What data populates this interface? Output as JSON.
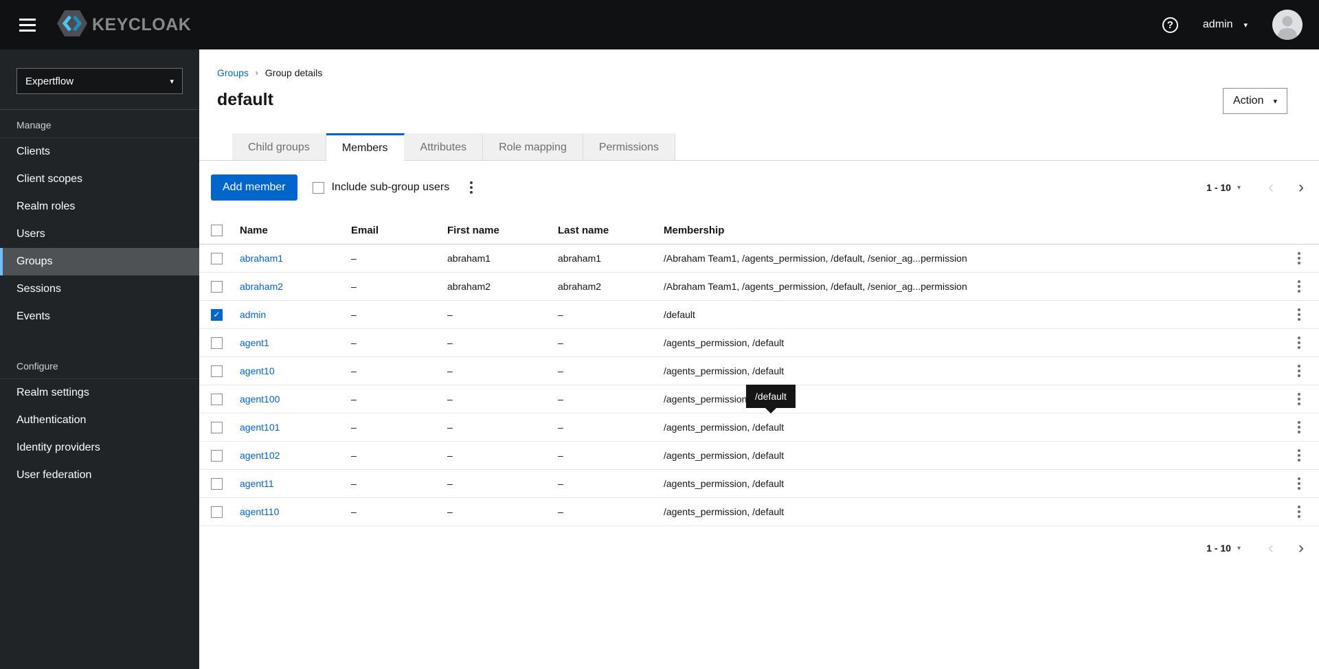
{
  "colors": {
    "accent": "#0066cc",
    "masthead_bg": "#0f1113",
    "sidebar_bg": "#212427",
    "nav_selected_bg": "#4f5255",
    "nav_selected_border": "#73bcf7",
    "tab_inactive_bg": "#f0f0f0",
    "link": "#0066cc",
    "tooltip_bg": "#151515",
    "brand_cyan": "#3fc0ee"
  },
  "icons": {
    "help": "?",
    "caret_down": "▾",
    "chevron_left": "‹",
    "chevron_right": "›",
    "breadcrumb_separator": "›",
    "check": "✓"
  },
  "masthead": {
    "brand": "KEYCLOAK",
    "username": "admin"
  },
  "sidebar": {
    "realm": "Expertflow",
    "selected": "Groups",
    "sections": [
      {
        "label": "Manage",
        "items": [
          "Clients",
          "Client scopes",
          "Realm roles",
          "Users",
          "Groups",
          "Sessions",
          "Events"
        ]
      },
      {
        "label": "Configure",
        "items": [
          "Realm settings",
          "Authentication",
          "Identity providers",
          "User federation"
        ]
      }
    ]
  },
  "breadcrumb": {
    "items": [
      "Groups",
      "Group details"
    ]
  },
  "header": {
    "title": "default",
    "action_label": "Action"
  },
  "tabs": {
    "active": "Members",
    "items": [
      "Child groups",
      "Members",
      "Attributes",
      "Role mapping",
      "Permissions"
    ]
  },
  "toolbar": {
    "add_member_label": "Add member",
    "include_subgroup_label": "Include sub-group users"
  },
  "pagination": {
    "range": "1 - 10"
  },
  "table": {
    "headers": [
      "Name",
      "Email",
      "First name",
      "Last name",
      "Membership"
    ],
    "rows": [
      {
        "name": "abraham1",
        "email": "–",
        "first_name": "abraham1",
        "last_name": "abraham1",
        "membership": "/Abraham Team1, /agents_permission, /default, /senior_ag...permission",
        "checked": false
      },
      {
        "name": "abraham2",
        "email": "–",
        "first_name": "abraham2",
        "last_name": "abraham2",
        "membership": "/Abraham Team1, /agents_permission, /default, /senior_ag...permission",
        "checked": false
      },
      {
        "name": "admin",
        "email": "–",
        "first_name": "–",
        "last_name": "–",
        "membership": "/default",
        "checked": true
      },
      {
        "name": "agent1",
        "email": "–",
        "first_name": "–",
        "last_name": "–",
        "membership": "/agents_permission, /default",
        "checked": false
      },
      {
        "name": "agent10",
        "email": "–",
        "first_name": "–",
        "last_name": "–",
        "membership": "/agents_permission, /default",
        "checked": false
      },
      {
        "name": "agent100",
        "email": "–",
        "first_name": "–",
        "last_name": "–",
        "membership": "/agents_permission, /default",
        "checked": false
      },
      {
        "name": "agent101",
        "email": "–",
        "first_name": "–",
        "last_name": "–",
        "membership": "/agents_permission, /default",
        "checked": false
      },
      {
        "name": "agent102",
        "email": "–",
        "first_name": "–",
        "last_name": "–",
        "membership": "/agents_permission, /default",
        "checked": false
      },
      {
        "name": "agent11",
        "email": "–",
        "first_name": "–",
        "last_name": "–",
        "membership": "/agents_permission, /default",
        "checked": false
      },
      {
        "name": "agent110",
        "email": "–",
        "first_name": "–",
        "last_name": "–",
        "membership": "/agents_permission, /default",
        "checked": false
      }
    ]
  },
  "tooltip": {
    "text": "/default"
  }
}
